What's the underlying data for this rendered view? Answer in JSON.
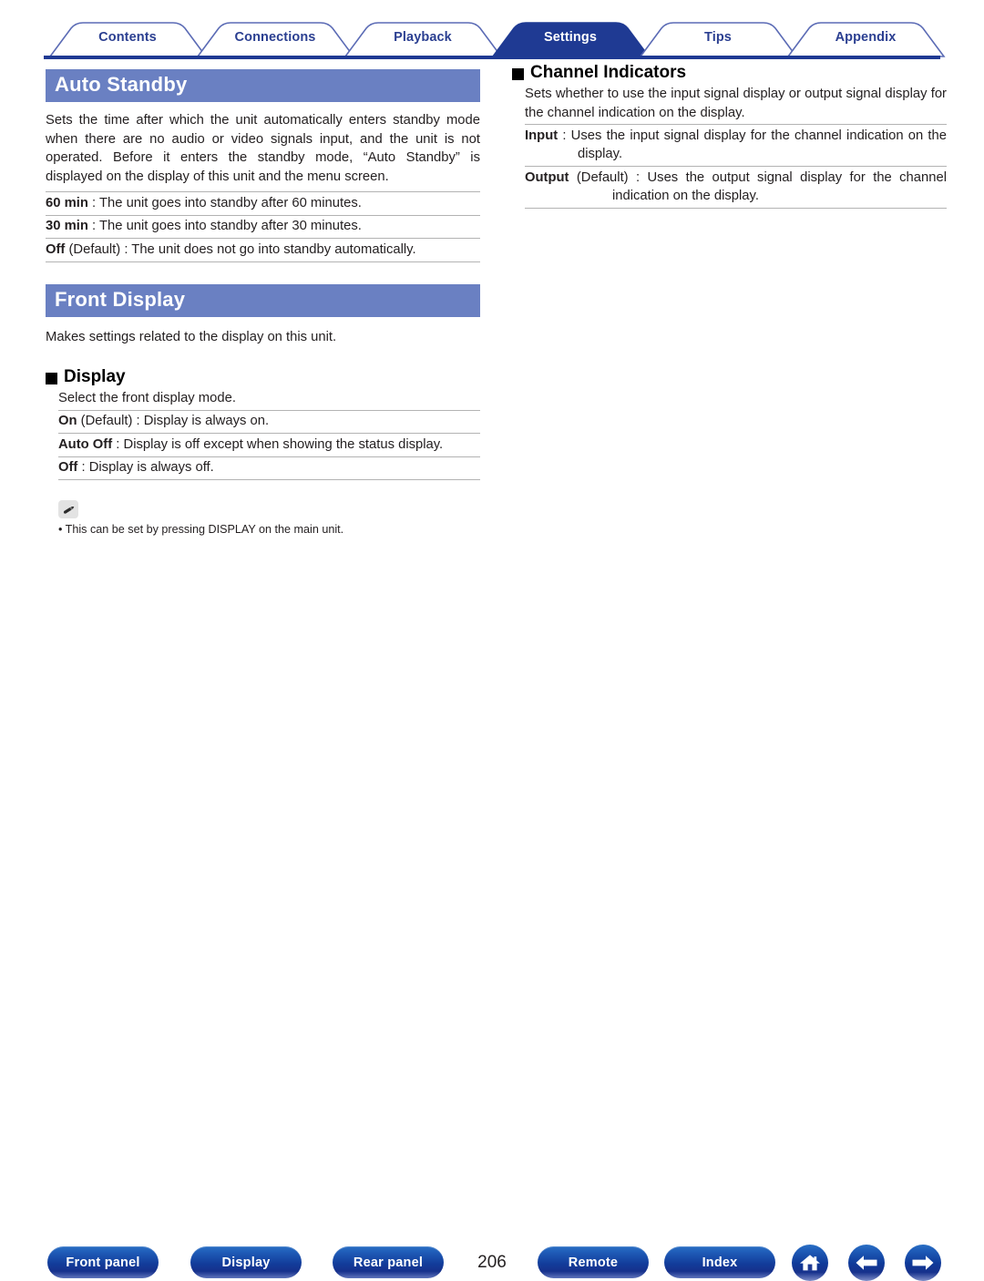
{
  "tabs": [
    {
      "label": "Contents",
      "active": false
    },
    {
      "label": "Connections",
      "active": false
    },
    {
      "label": "Playback",
      "active": false
    },
    {
      "label": "Settings",
      "active": true
    },
    {
      "label": "Tips",
      "active": false
    },
    {
      "label": "Appendix",
      "active": false
    }
  ],
  "left": {
    "auto_standby": {
      "title": "Auto Standby",
      "intro": "Sets the time after which the unit automatically enters standby mode when there are no audio or video signals input, and the unit is not operated. Before it enters the standby mode, “Auto Standby” is displayed on the display of this unit and the menu screen.",
      "options": [
        {
          "term": "60 min",
          "rest": " : The unit goes into standby after 60 minutes."
        },
        {
          "term": "30 min",
          "rest": " : The unit goes into standby after 30 minutes."
        },
        {
          "term": "Off",
          "rest": " (Default) : The unit does not go into standby automatically."
        }
      ]
    },
    "front_display": {
      "title": "Front Display",
      "intro": "Makes settings related to the display on this unit.",
      "subsection": {
        "heading": "Display",
        "description": "Select the front display mode.",
        "options": [
          {
            "term": "On",
            "rest": " (Default) : Display is always on."
          },
          {
            "term": "Auto Off",
            "rest": " : Display is off except when showing the status display."
          },
          {
            "term": "Off",
            "rest": " : Display is always off."
          }
        ]
      }
    },
    "note": {
      "icon": "pencil-icon",
      "text": "• This can be set by pressing DISPLAY on the main unit."
    }
  },
  "right": {
    "channel_indicators": {
      "heading": "Channel Indicators",
      "description": "Sets whether to use the input signal display or output signal display for the channel indication on the display.",
      "options": [
        {
          "term": "Input",
          "rest": " : Uses the input signal display for the channel indication on the display."
        },
        {
          "term": "Output",
          "rest": " (Default) : Uses the output signal display for the channel indication on the display."
        }
      ]
    }
  },
  "footer": {
    "buttons": [
      {
        "label": "Front panel"
      },
      {
        "label": "Display"
      },
      {
        "label": "Rear panel"
      },
      {
        "label": "Remote"
      },
      {
        "label": "Index"
      }
    ],
    "page_number": "206",
    "icons": [
      {
        "name": "home-icon"
      },
      {
        "name": "arrow-left-icon"
      },
      {
        "name": "arrow-right-icon"
      }
    ]
  },
  "colors": {
    "tab_active_fill": "#1f3a93",
    "tab_text": "#2b3f91",
    "banner": "#6a80c2",
    "rule": "#b3b3b3",
    "button_blue": "#16318c"
  }
}
